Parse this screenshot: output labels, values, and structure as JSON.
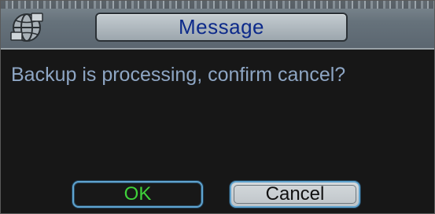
{
  "dialog": {
    "title": "Message",
    "icon": "network-globe-icon",
    "message": "Backup is processing, confirm cancel?"
  },
  "buttons": {
    "ok_label": "OK",
    "cancel_label": "Cancel"
  },
  "colors": {
    "title_text": "#0d2a8a",
    "message_text": "#8ea6c4",
    "ok_text": "#3fd23a",
    "button_border": "#5fa3cf",
    "background": "#171717"
  }
}
